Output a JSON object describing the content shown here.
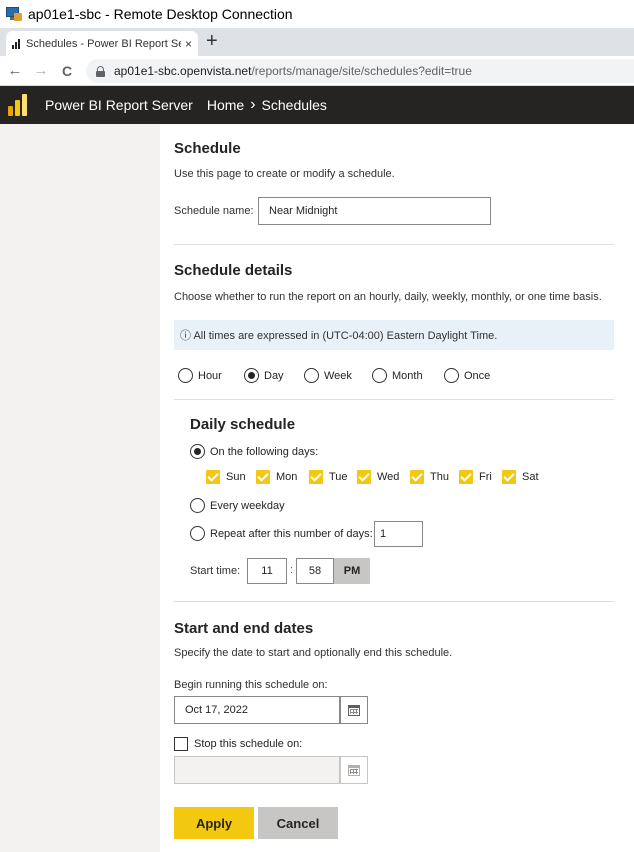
{
  "rdp": {
    "title": "ap01e1-sbc - Remote Desktop Connection"
  },
  "browser": {
    "tab_title": "Schedules - Power BI Report Serv",
    "tab_close": "×",
    "new_tab": "+",
    "back": "←",
    "forward": "→",
    "reload": "C",
    "url_host": "ap01e1-sbc.openvista.net",
    "url_path": "/reports/manage/site/schedules?edit=true"
  },
  "header": {
    "brand": "Power BI Report Server",
    "breadcrumb_home": "Home",
    "breadcrumb_sep": "›",
    "breadcrumb_current": "Schedules",
    "logo_colors": [
      "#e8a400",
      "#f2c811",
      "#fbe06d"
    ]
  },
  "schedule": {
    "title": "Schedule",
    "description": "Use this page to create or modify a schedule.",
    "name_label": "Schedule name:",
    "name_value": "Near Midnight"
  },
  "details": {
    "title": "Schedule details",
    "description": "Choose whether to run the report on an hourly, daily, weekly, monthly, or one time basis.",
    "timezone_info": "ⓘ All times are expressed in (UTC-04:00) Eastern Daylight Time.",
    "frequency_options": [
      "Hour",
      "Day",
      "Week",
      "Month",
      "Once"
    ],
    "selected_frequency": "Day"
  },
  "daily": {
    "title": "Daily schedule",
    "following_days_label": "On the following days:",
    "days": [
      "Sun",
      "Mon",
      "Tue",
      "Wed",
      "Thu",
      "Fri",
      "Sat"
    ],
    "days_checked": [
      true,
      true,
      true,
      true,
      true,
      true,
      true
    ],
    "every_weekday_label": "Every weekday",
    "repeat_label": "Repeat after this number of days:",
    "repeat_value": "1",
    "selected_option": "On the following days:",
    "start_time_label": "Start time:",
    "hour": "11",
    "colon": ":",
    "minute": "58",
    "ampm": "PM"
  },
  "dates": {
    "title": "Start and end dates",
    "description": "Specify the date to start and optionally end this schedule.",
    "begin_label": "Begin running this schedule on:",
    "begin_value": "Oct 17, 2022",
    "stop_label": "Stop this schedule on:",
    "stop_checked": false,
    "stop_value": ""
  },
  "actions": {
    "apply": "Apply",
    "cancel": "Cancel",
    "apply_color": "#f2c811",
    "cancel_color": "#c8c6c4"
  }
}
